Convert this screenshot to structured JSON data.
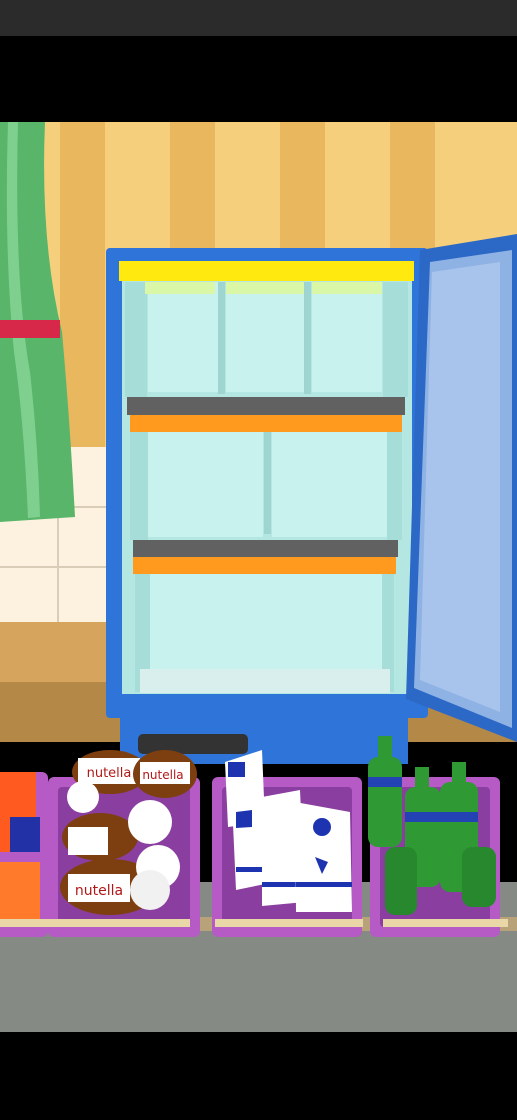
{
  "app": {
    "name": "fridge-organizing-game"
  },
  "colors": {
    "wall_light": "#f6cf7c",
    "wall_dark": "#e9b75e",
    "fridge_body": "#2f74d8",
    "fridge_interior": "#c8f2ee",
    "shelf_top": "#ffe90f",
    "shelf_mid": "#ff9a1f",
    "shelf_bar": "#616161",
    "floor": "#868a84",
    "basket": "#b65bc6"
  },
  "fridge": {
    "shelves": [
      {
        "name": "top-shelf",
        "slots": 3
      },
      {
        "name": "middle-shelf",
        "slots": 2
      },
      {
        "name": "bottom-shelf",
        "slots": 1
      }
    ]
  },
  "baskets": [
    {
      "name": "basket-cheese",
      "item": "cheese"
    },
    {
      "name": "basket-nutella",
      "item": "nutella",
      "label": "nutella"
    },
    {
      "name": "basket-milk",
      "item": "milk"
    },
    {
      "name": "basket-soda",
      "item": "green-bottle"
    }
  ]
}
